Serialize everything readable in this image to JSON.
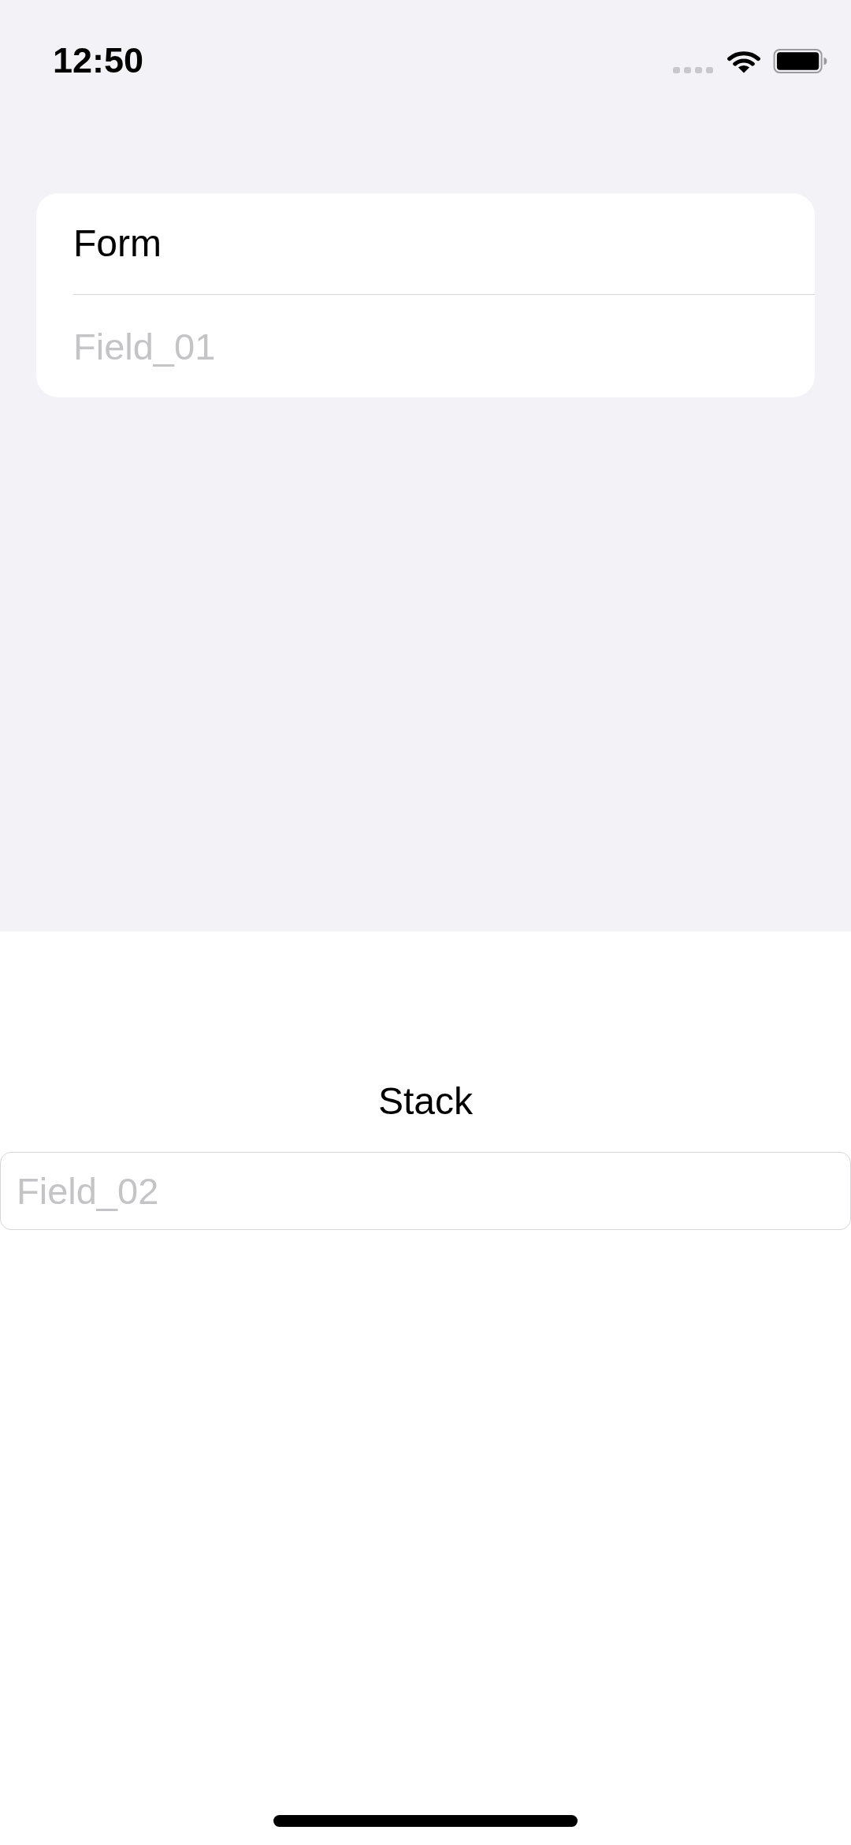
{
  "status_bar": {
    "time": "12:50"
  },
  "form": {
    "title": "Form",
    "field": {
      "placeholder": "Field_01"
    }
  },
  "stack": {
    "title": "Stack",
    "field": {
      "placeholder": "Field_02"
    }
  }
}
